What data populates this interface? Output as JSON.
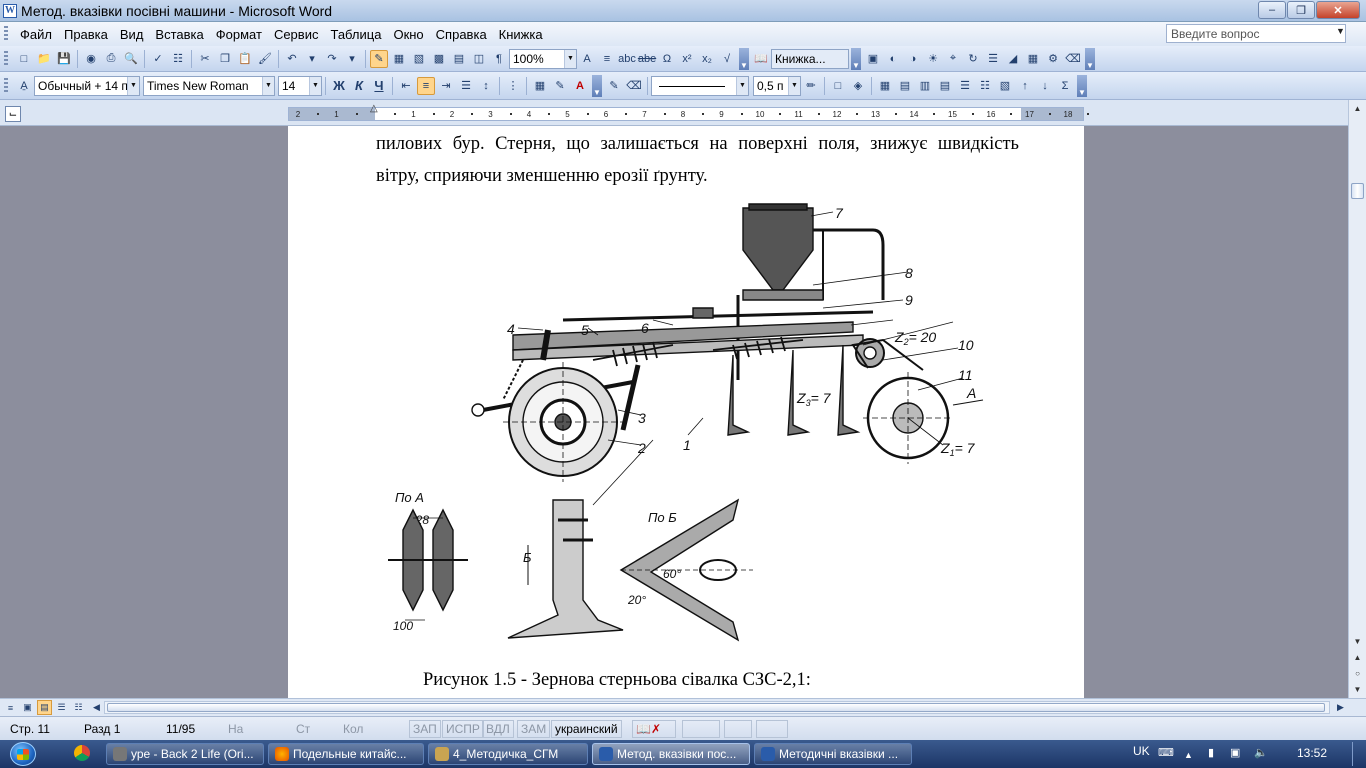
{
  "window": {
    "title": "Метод. вказівки посівні машини - Microsoft Word",
    "app_icon": "W"
  },
  "menu": {
    "items": [
      "Файл",
      "Правка",
      "Вид",
      "Вставка",
      "Формат",
      "Сервис",
      "Таблица",
      "Окно",
      "Справка",
      "Книжка"
    ],
    "ask_placeholder": "Введите вопрос"
  },
  "toolbar1": {
    "zoom": "100%",
    "book_label": "Книжка..."
  },
  "toolbar2": {
    "style": "Обычный + 14 п",
    "font": "Times New Roman",
    "size": "14",
    "bold": "Ж",
    "italic": "К",
    "underline": "Ч",
    "line_width": "0,5 п"
  },
  "ruler": {
    "labels": [
      "2",
      "1",
      "1",
      "2",
      "3",
      "4",
      "5",
      "6",
      "7",
      "8",
      "9",
      "10",
      "11",
      "12",
      "13",
      "14",
      "15",
      "16",
      "17",
      "18"
    ]
  },
  "document": {
    "line1": "пилових бур. Стерня, що залишається на поверхні поля, знижує швидкість",
    "line2": "вітру, сприяючи зменшенню ерозії ґрунту.",
    "caption": "Рисунок 1.5 - Зернова стерньова сівалка СЗС-2,1:",
    "figure": {
      "labels": [
        "7",
        "8",
        "9",
        "4",
        "5",
        "6",
        "Z",
        "2",
        "= 20",
        "10",
        "11",
        "3",
        "2",
        "1",
        "Z",
        "3",
        "= 7",
        "A",
        "Z",
        "1",
        "= 7",
        "По А",
        "228",
        "100",
        "Б",
        "По Б",
        "60°",
        "20°"
      ]
    }
  },
  "status": {
    "page": "Стр. 11",
    "section": "Разд 1",
    "pages": "11/95",
    "at": "На",
    "line": "Ст",
    "col": "Кол",
    "rec": "ЗАП",
    "trk": "ИСПР",
    "ext": "ВДЛ",
    "ovr": "ЗАМ",
    "language": "украинский"
  },
  "taskbar": {
    "items": [
      "уре - Back 2 Life (Ori...",
      "Подельные китайс...",
      "4_Методичка_СГМ",
      "Метод. вказівки пос...",
      "Методичні вказівки ..."
    ],
    "lang": "UK",
    "time": "13:52"
  }
}
